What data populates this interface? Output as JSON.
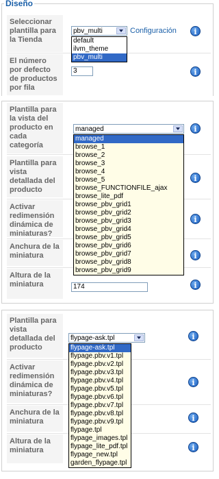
{
  "section": {
    "legend": "Diseño"
  },
  "store": {
    "template_label": "Seleccionar plantilla para la Tienda",
    "template_value": "pbv_multi",
    "template_options": [
      "default",
      "ilvm_theme",
      "pbv_multi"
    ],
    "config_link": "Configuración",
    "products_per_row_label": "El número por defecto de productos por fila",
    "products_per_row_value": "3"
  },
  "category": {
    "browse_label": "Plantilla para la vista del producto en cada categoría",
    "browse_value": "managed",
    "browse_options": [
      "managed",
      "browse_1",
      "browse_2",
      "browse_3",
      "browse_4",
      "browse_5",
      "browse_FUNCTIONFILE_ajax",
      "browse_lite_pdf",
      "browse_pbv_grid1",
      "browse_pbv_grid2",
      "browse_pbv_grid3",
      "browse_pbv_grid4",
      "browse_pbv_grid5",
      "browse_pbv_grid6",
      "browse_pbv_grid7",
      "browse_pbv_grid8",
      "browse_pbv_grid9"
    ],
    "flypage_label": "Plantilla para vista detallada del producto",
    "resize_label": "Activar redimensión dinámica de miniaturas?",
    "width_label": "Anchura de la miniatura",
    "height_label": "Altura de la miniatura",
    "height_value": "174"
  },
  "detail": {
    "flypage_label": "Plantilla para vista detallada del producto",
    "flypage_value": "flypage-ask.tpl",
    "flypage_options": [
      "flypage-ask.tpl",
      "flypage.pbv.v1.tpl",
      "flypage.pbv.v2.tpl",
      "flypage.pbv.v3.tpl",
      "flypage.pbv.v4.tpl",
      "flypage.pbv.v5.tpl",
      "flypage.pbv.v6.tpl",
      "flypage.pbv.v7.tpl",
      "flypage.pbv.v8.tpl",
      "flypage.pbv.v9.tpl",
      "flypage.tpl",
      "flypage_images.tpl",
      "flypage_lite_pdf.tpl",
      "flypage_new.tpl",
      "garden_flypage.tpl"
    ],
    "resize_label": "Activar redimensión dinámica de miniaturas?",
    "width_label": "Anchura de la miniatura",
    "height_label": "Altura de la miniatura"
  },
  "icons": {
    "info": "info-icon",
    "info_glyph": "i"
  }
}
